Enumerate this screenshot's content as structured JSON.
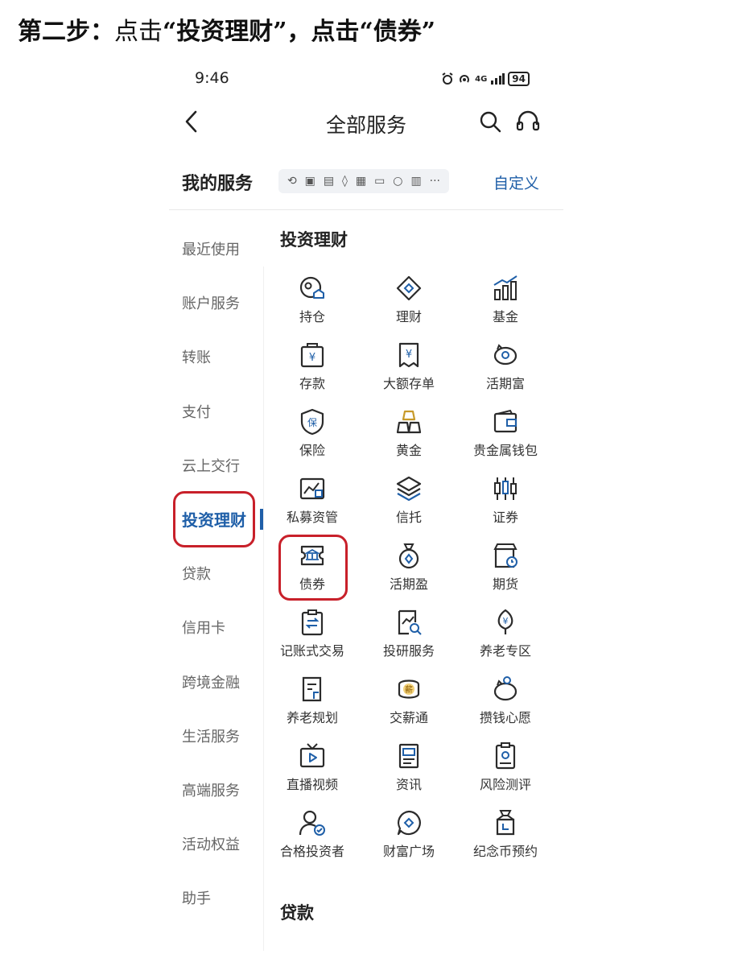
{
  "instruction": {
    "part1": "第二步：",
    "part2": "点击",
    "part3": "“投资理财”，",
    "part4": "点击",
    "part5": "“债券”"
  },
  "status_bar": {
    "time": "9:46",
    "network": "4G",
    "battery": "94"
  },
  "header": {
    "title": "全部服务"
  },
  "my_services": {
    "label": "我的服务",
    "customize": "自定义",
    "more": "···"
  },
  "sidebar": {
    "items": [
      "最近使用",
      "账户服务",
      "转账",
      "支付",
      "云上交行",
      "投资理财",
      "贷款",
      "信用卡",
      "跨境金融",
      "生活服务",
      "高端服务",
      "活动权益",
      "助手"
    ],
    "active_index": 5
  },
  "section": {
    "title": "投资理财",
    "items": [
      {
        "label": "持仓",
        "icon": "holdings-icon"
      },
      {
        "label": "理财",
        "icon": "wealth-icon"
      },
      {
        "label": "基金",
        "icon": "fund-icon"
      },
      {
        "label": "存款",
        "icon": "deposit-icon"
      },
      {
        "label": "大额存单",
        "icon": "large-cd-icon"
      },
      {
        "label": "活期富",
        "icon": "piggy-icon"
      },
      {
        "label": "保险",
        "icon": "insurance-shield-icon"
      },
      {
        "label": "黄金",
        "icon": "gold-bars-icon"
      },
      {
        "label": "贵金属钱包",
        "icon": "wallet-icon"
      },
      {
        "label": "私募资管",
        "icon": "private-fund-icon"
      },
      {
        "label": "信托",
        "icon": "layers-icon"
      },
      {
        "label": "证券",
        "icon": "candlestick-icon"
      },
      {
        "label": "债券",
        "icon": "bond-bank-icon"
      },
      {
        "label": "活期盈",
        "icon": "money-bag-icon"
      },
      {
        "label": "期货",
        "icon": "futures-icon"
      },
      {
        "label": "记账式交易",
        "icon": "exchange-clipboard-icon"
      },
      {
        "label": "投研服务",
        "icon": "research-icon"
      },
      {
        "label": "养老专区",
        "icon": "pension-tree-icon"
      },
      {
        "label": "养老规划",
        "icon": "plan-document-icon"
      },
      {
        "label": "交薪通",
        "icon": "salary-icon"
      },
      {
        "label": "攒钱心愿",
        "icon": "savings-wish-icon"
      },
      {
        "label": "直播视频",
        "icon": "tv-play-icon"
      },
      {
        "label": "资讯",
        "icon": "news-icon"
      },
      {
        "label": "风险测评",
        "icon": "risk-assessment-icon"
      },
      {
        "label": "合格投资者",
        "icon": "investor-icon"
      },
      {
        "label": "财富广场",
        "icon": "wealth-plaza-icon"
      },
      {
        "label": "纪念币预约",
        "icon": "coin-reservation-icon"
      }
    ],
    "salary_icon_char": "薪",
    "insurance_icon_char": "保",
    "currency_char": "¥"
  },
  "next_section": {
    "title": "贷款"
  },
  "colors": {
    "accent": "#1f5fa8",
    "highlight": "#c8202a",
    "icon_stroke": "#2b2b2b"
  }
}
